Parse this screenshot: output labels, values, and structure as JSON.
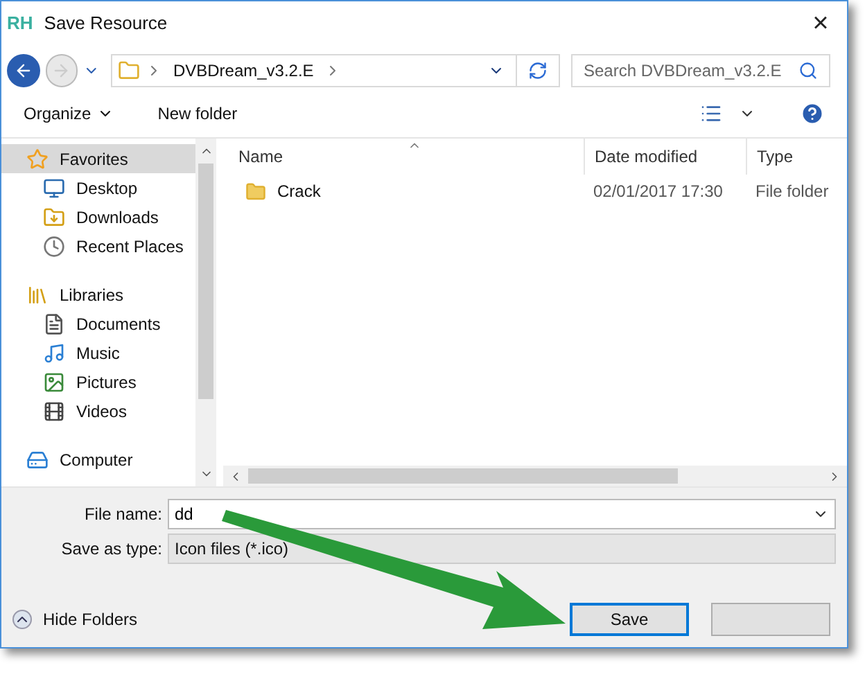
{
  "window": {
    "logo": "RH",
    "title": "Save Resource",
    "close": "×"
  },
  "address": {
    "path": [
      "DVBDream_v3.2.E"
    ],
    "search_placeholder": "Search DVBDream_v3.2.E"
  },
  "toolbar": {
    "organize": "Organize",
    "new_folder": "New folder"
  },
  "sidebar": {
    "groups": [
      {
        "label": "Favorites",
        "selected": true,
        "children": [
          {
            "label": "Desktop"
          },
          {
            "label": "Downloads"
          },
          {
            "label": "Recent Places"
          }
        ]
      },
      {
        "label": "Libraries",
        "selected": false,
        "children": [
          {
            "label": "Documents"
          },
          {
            "label": "Music"
          },
          {
            "label": "Pictures"
          },
          {
            "label": "Videos"
          }
        ]
      },
      {
        "label": "Computer",
        "selected": false
      }
    ]
  },
  "table": {
    "columns": [
      "Name",
      "Date modified",
      "Type"
    ],
    "rows": [
      {
        "name": "Crack",
        "date": "02/01/2017 17:30",
        "type": "File folder"
      }
    ]
  },
  "form": {
    "file_name_label": "File name:",
    "file_name": "dd",
    "type_label": "Save as type:",
    "type": "Icon files (*.ico)"
  },
  "hide_folders": "Hide Folders",
  "buttons": [
    {
      "label": "Save",
      "kind": "primary"
    },
    {
      "kind": "secondary"
    }
  ]
}
